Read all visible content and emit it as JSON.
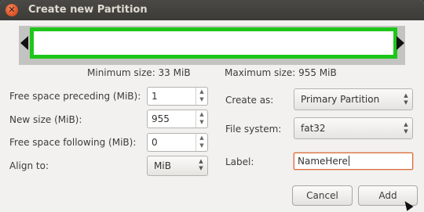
{
  "window": {
    "title": "Create new Partition",
    "close_icon_glyph": "✕"
  },
  "sizes": {
    "minimum": "Minimum size: 33 MiB",
    "maximum": "Maximum size: 955 MiB"
  },
  "left_form": {
    "preceding_label": "Free space preceding (MiB):",
    "preceding_value": "1",
    "new_size_label": "New size (MiB):",
    "new_size_value": "955",
    "following_label": "Free space following (MiB):",
    "following_value": "0",
    "align_label": "Align to:",
    "align_value": "MiB"
  },
  "right_form": {
    "create_as_label": "Create as:",
    "create_as_value": "Primary Partition",
    "filesystem_label": "File system:",
    "filesystem_value": "fat32",
    "name_label": "Label:",
    "name_value": "NameHere"
  },
  "buttons": {
    "cancel": "Cancel",
    "add": "Add"
  },
  "icons": {
    "spin_up": "▲",
    "spin_down": "▼"
  },
  "colors": {
    "partition_border": "#1ec61a",
    "focus_border": "#d86a3a",
    "close_button": "#e35a2c"
  }
}
